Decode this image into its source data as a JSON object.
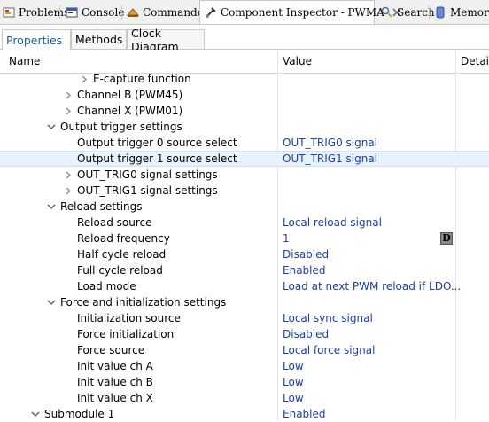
{
  "view_tabs": [
    {
      "label": "Problems",
      "icon": "problems-icon"
    },
    {
      "label": "Console",
      "icon": "console-icon"
    },
    {
      "label": "Commander",
      "icon": "commander-icon"
    },
    {
      "label": "Component Inspector - PWMA",
      "icon": "component-inspector-icon"
    },
    {
      "label": "Search",
      "icon": "search-icon"
    },
    {
      "label": "Memory",
      "icon": "memory-icon"
    }
  ],
  "inner_tabs": [
    {
      "label": "Properties"
    },
    {
      "label": "Methods"
    },
    {
      "label": "Clock Diagram"
    }
  ],
  "columns": {
    "name": "Name",
    "value": "Value",
    "details": "Detail"
  },
  "rows": [
    {
      "label": "E-capture function",
      "value": ""
    },
    {
      "label": "Channel B (PWM45)",
      "value": ""
    },
    {
      "label": "Channel X (PWM01)",
      "value": ""
    },
    {
      "label": "Output trigger settings",
      "value": ""
    },
    {
      "label": "Output trigger 0 source select",
      "value": "OUT_TRIG0 signal"
    },
    {
      "label": "Output trigger 1 source select",
      "value": "OUT_TRIG1 signal"
    },
    {
      "label": "OUT_TRIG0 signal settings",
      "value": ""
    },
    {
      "label": "OUT_TRIG1 signal settings",
      "value": ""
    },
    {
      "label": "Reload settings",
      "value": ""
    },
    {
      "label": "Reload source",
      "value": "Local reload signal"
    },
    {
      "label": "Reload frequency",
      "value": "1",
      "badge": "D"
    },
    {
      "label": "Half cycle reload",
      "value": "Disabled"
    },
    {
      "label": "Full cycle reload",
      "value": "Enabled"
    },
    {
      "label": "Load mode",
      "value": "Load at next PWM reload if LDO..."
    },
    {
      "label": "Force and initialization settings",
      "value": ""
    },
    {
      "label": "Initialization source",
      "value": "Local sync signal"
    },
    {
      "label": "Force initialization",
      "value": "Disabled"
    },
    {
      "label": "Force source",
      "value": "Local force signal"
    },
    {
      "label": "Init value ch A",
      "value": "Low"
    },
    {
      "label": "Init value ch B",
      "value": "Low"
    },
    {
      "label": "Init value ch X",
      "value": "Low"
    },
    {
      "label": "Submodule 1",
      "value": "Enabled"
    }
  ]
}
